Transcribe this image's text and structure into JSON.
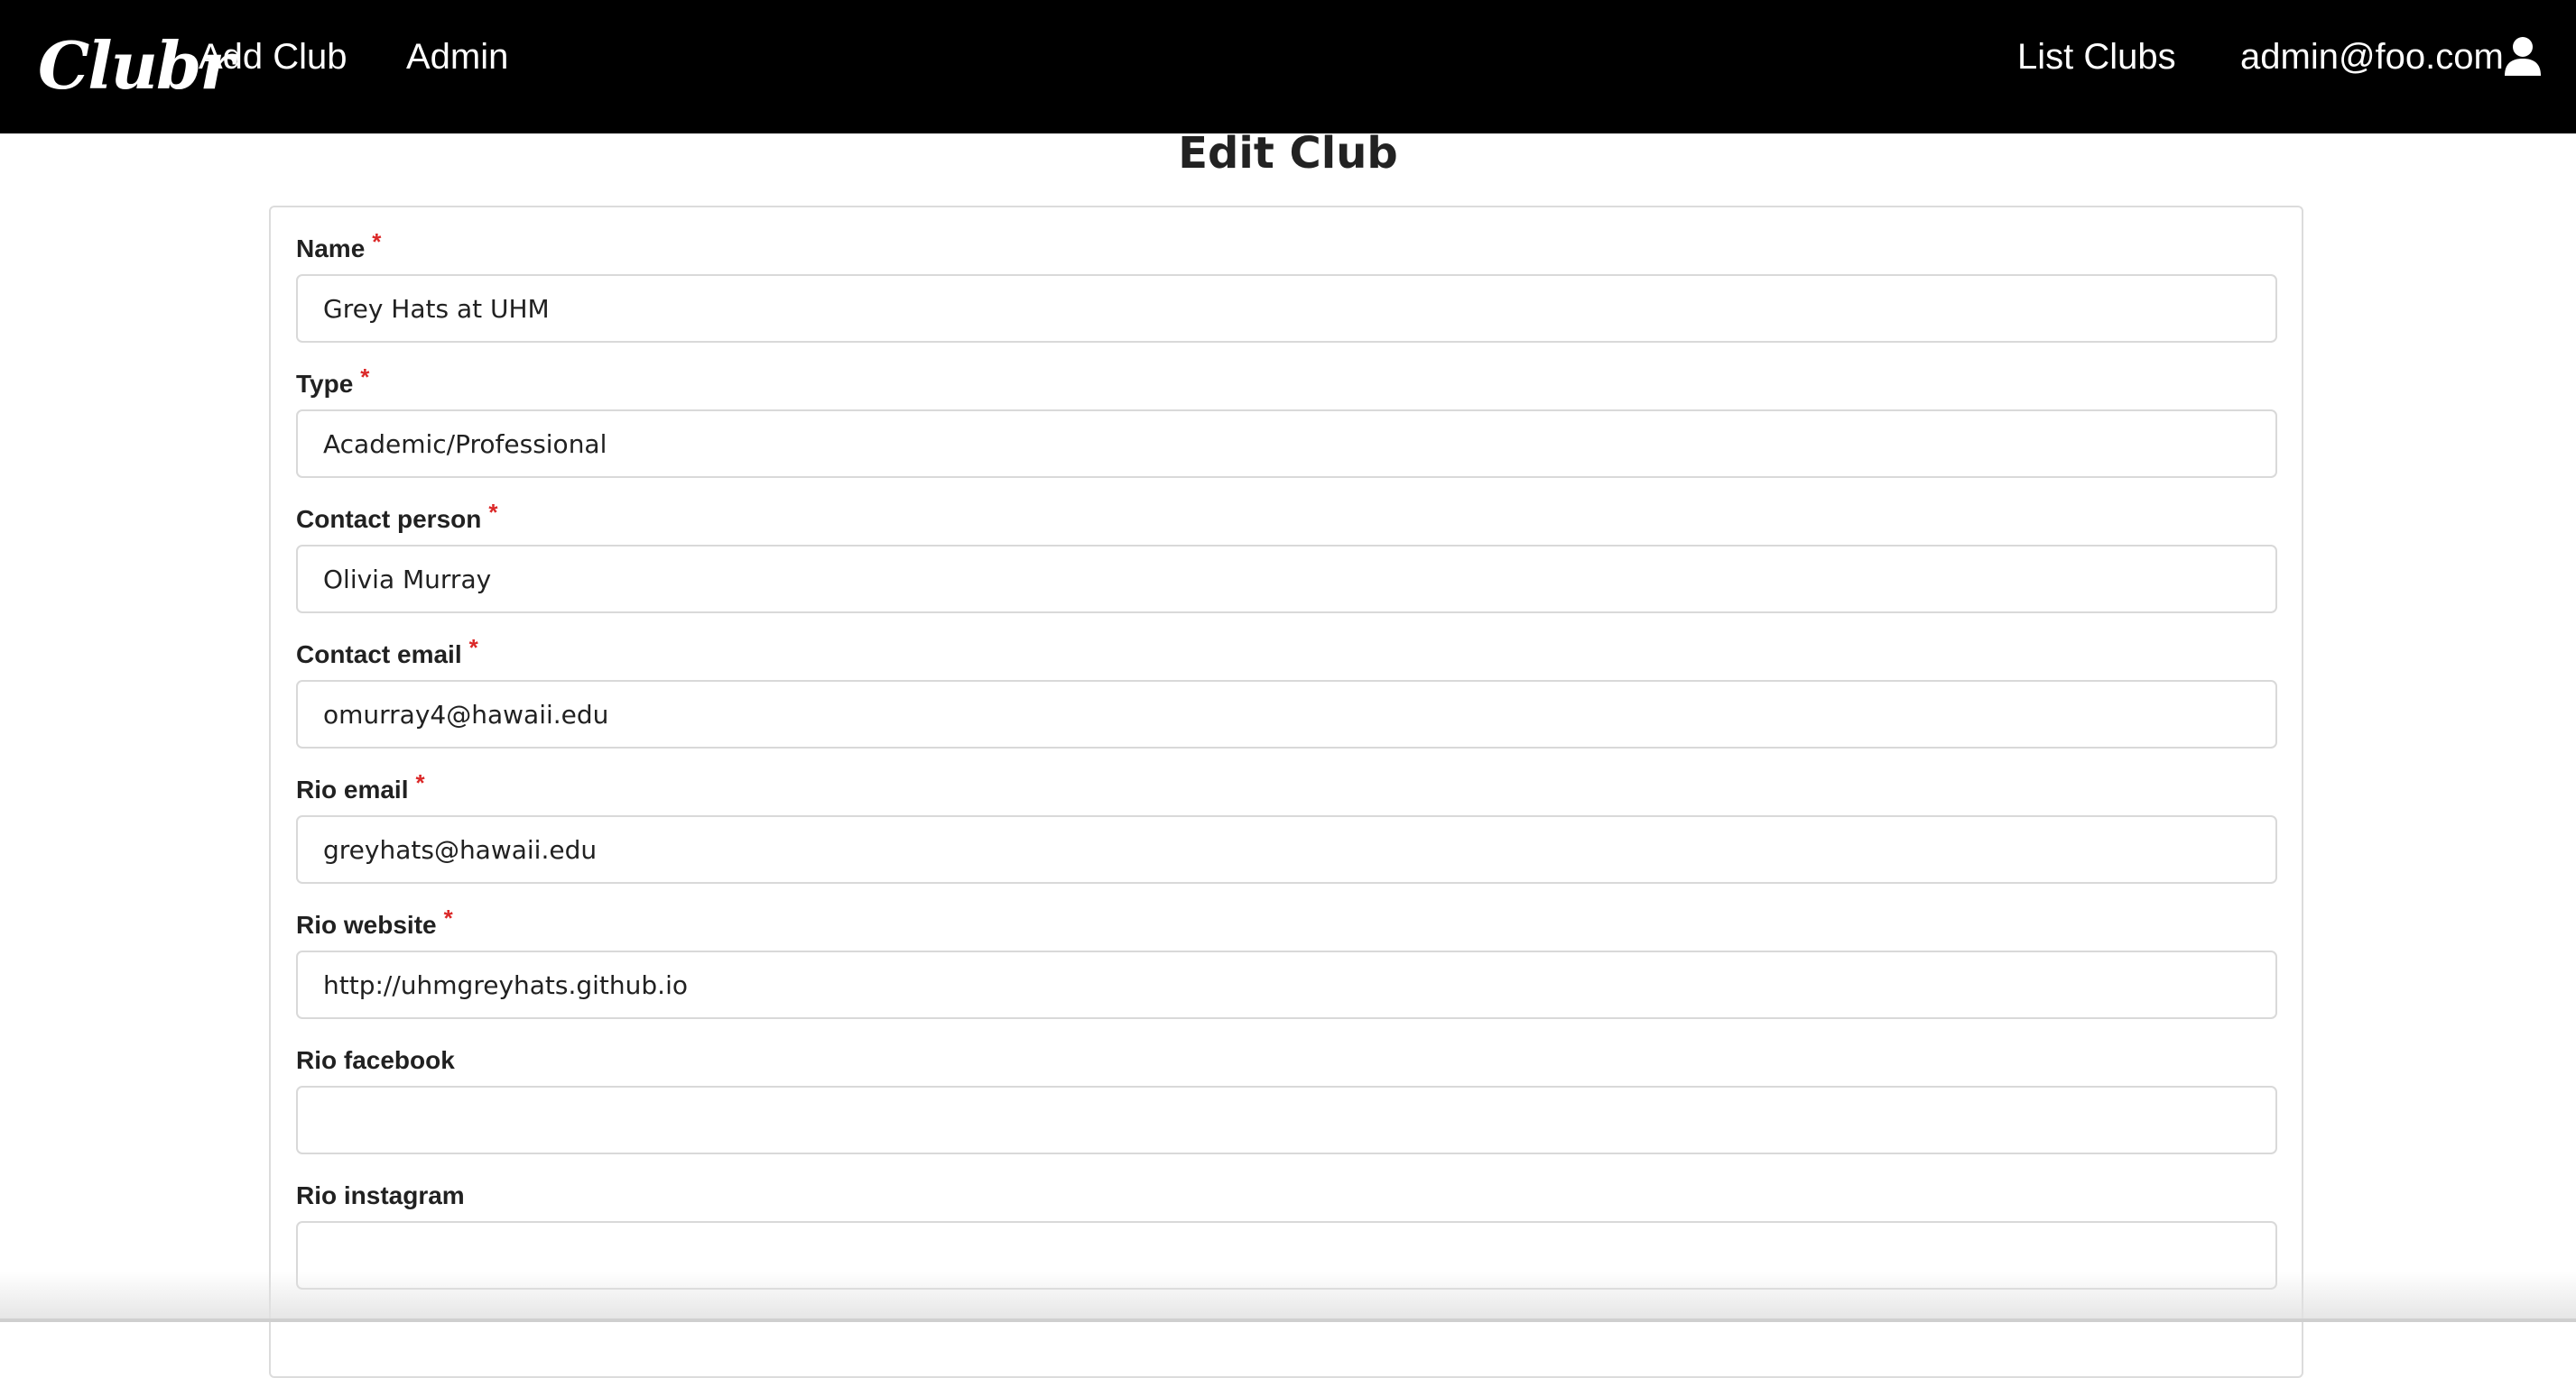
{
  "nav": {
    "logo": "Clubr",
    "add_club": "Add Club",
    "admin": "Admin",
    "list_clubs": "List Clubs",
    "user_email": "admin@foo.com"
  },
  "page": {
    "title": "Edit Club"
  },
  "form": {
    "fields": [
      {
        "label": "Name",
        "required": "*",
        "value": "Grey Hats at UHM"
      },
      {
        "label": "Type",
        "required": "*",
        "value": "Academic/Professional"
      },
      {
        "label": "Contact person",
        "required": "*",
        "value": "Olivia Murray"
      },
      {
        "label": "Contact email",
        "required": "*",
        "value": "omurray4@hawaii.edu"
      },
      {
        "label": "Rio email",
        "required": "*",
        "value": "greyhats@hawaii.edu"
      },
      {
        "label": "Rio website",
        "required": "*",
        "value": "http://uhmgreyhats.github.io"
      },
      {
        "label": "Rio facebook",
        "required": "",
        "value": ""
      },
      {
        "label": "Rio instagram",
        "required": "",
        "value": ""
      }
    ]
  }
}
